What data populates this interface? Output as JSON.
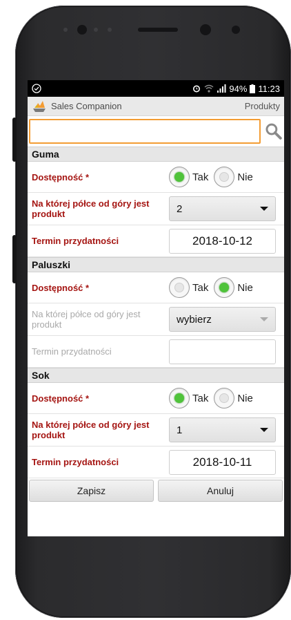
{
  "status": {
    "time": "11:23",
    "battery": "94%",
    "icons": [
      "check-circle-icon",
      "alarm-icon",
      "wifi-icon",
      "signal-icon",
      "battery-icon"
    ]
  },
  "app": {
    "title": "Sales Companion",
    "section_link": "Produkty"
  },
  "search": {
    "value": "",
    "placeholder": ""
  },
  "accent_colors": {
    "required_label": "#a51512",
    "search_border": "#f39c33",
    "radio_on": "#4fc33a"
  },
  "products": [
    {
      "name": "Guma",
      "availability_label": "Dostępność *",
      "yes_label": "Tak",
      "no_label": "Nie",
      "selected": "Tak",
      "shelf_label": "Na której półce od góry jest produkt",
      "shelf_value": "2",
      "expiry_label": "Termin przydatności",
      "expiry_value": "2018-10-12"
    },
    {
      "name": "Paluszki",
      "availability_label": "Dostępność *",
      "yes_label": "Tak",
      "no_label": "Nie",
      "selected": "Nie",
      "shelf_label": "Na której półce od góry jest produkt",
      "shelf_value": "wybierz",
      "expiry_label": "Termin przydatności",
      "expiry_value": ""
    },
    {
      "name": "Sok",
      "availability_label": "Dostępność *",
      "yes_label": "Tak",
      "no_label": "Nie",
      "selected": "Tak",
      "shelf_label": "Na której półce od góry jest produkt",
      "shelf_value": "1",
      "expiry_label": "Termin przydatności",
      "expiry_value": "2018-10-11"
    }
  ],
  "actions": {
    "save_label": "Zapisz",
    "cancel_label": "Anuluj"
  }
}
